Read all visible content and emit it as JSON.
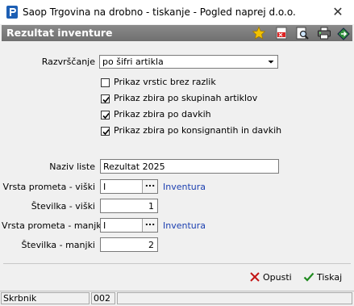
{
  "window": {
    "title": "Saop Trgovina na drobno - tiskanje - Pogled naprej d.o.o.",
    "close_glyph": "✕"
  },
  "header": {
    "title": "Rezultat inventure"
  },
  "toolbar": {
    "icons": [
      "star-icon",
      "pdf-icon",
      "print-preview-icon",
      "printer-icon",
      "export-icon"
    ]
  },
  "form": {
    "sort_label": "Razvrščanje",
    "sort_value": "po šifri artikla",
    "checkboxes": [
      {
        "label": "Prikaz vrstic brez razlik",
        "checked": false
      },
      {
        "label": "Prikaz zbira po skupinah artiklov",
        "checked": true
      },
      {
        "label": "Prikaz zbira po davkih",
        "checked": true
      },
      {
        "label": "Prikaz zbira po konsignantih in davkih",
        "checked": true
      }
    ],
    "list_name_label": "Naziv liste",
    "list_name_value": "Rezultat 2025",
    "surplus_type_label": "Vrsta prometa - viški",
    "surplus_type_value": "I",
    "surplus_type_desc": "Inventura",
    "surplus_number_label": "Številka - viški",
    "surplus_number_value": "1",
    "shortage_type_label": "Vrsta prometa - manjki",
    "shortage_type_value": "I",
    "shortage_type_desc": "Inventura",
    "shortage_number_label": "Številka - manjki",
    "shortage_number_value": "2",
    "dots": "..."
  },
  "buttons": {
    "cancel": "Opusti",
    "print": "Tiskaj"
  },
  "status": {
    "user": "Skrbnik",
    "code": "002"
  },
  "colors": {
    "header": "#7a7a7a",
    "link": "#1b3fb0",
    "accent_star": "#e8b400"
  }
}
